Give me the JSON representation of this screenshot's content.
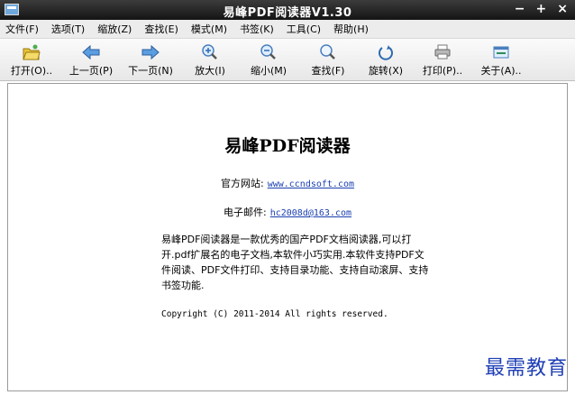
{
  "titlebar": {
    "title": "易峰PDF阅读器V1.30",
    "minimize": "−",
    "maximize": "+",
    "close": "×"
  },
  "menu": [
    "文件(F)",
    "选项(T)",
    "缩放(Z)",
    "查找(E)",
    "模式(M)",
    "书签(K)",
    "工具(C)",
    "帮助(H)"
  ],
  "toolbar": {
    "open": "打开(O)..",
    "prev": "上一页(P)",
    "next": "下一页(N)",
    "zoom_in": "放大(I)",
    "zoom_out": "缩小(M)",
    "find": "查找(F)",
    "rotate": "旋转(X)",
    "print": "打印(P)..",
    "about": "关于(A).."
  },
  "about": {
    "heading": "易峰PDF阅读器",
    "website_label": "官方网站:",
    "website": "www.ccndsoft.com",
    "email_label": "电子邮件:",
    "email": "hc2008d@163.com",
    "description": "易峰PDF阅读器是一款优秀的国产PDF文档阅读器,可以打开.pdf扩展名的电子文档,本软件小巧实用.本软件支持PDF文件阅读、PDF文件打印、支持目录功能、支持自动滚屏、支持书签功能.",
    "copyright": "Copyright (C) 2011-2014 All rights reserved."
  },
  "watermark": "最需教育",
  "colors": {
    "titlebar": "#1c1c1c",
    "link": "#1a3fb0",
    "watermark": "#1f3fb5"
  }
}
